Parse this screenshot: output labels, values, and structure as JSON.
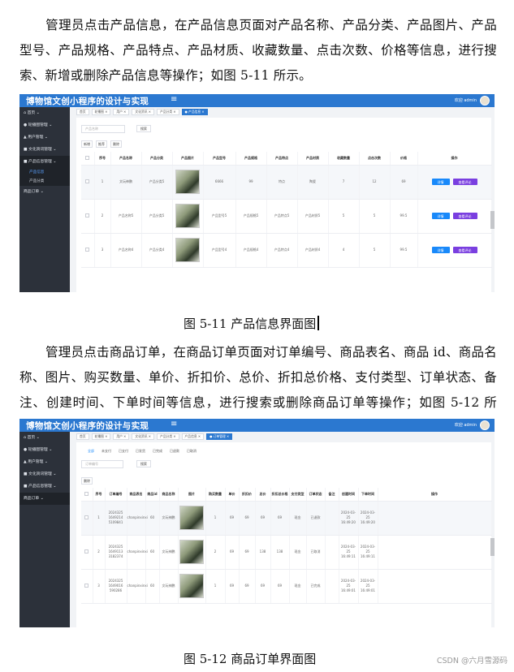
{
  "para1": "管理员点击产品信息，在产品信息页面对产品名称、产品分类、产品图片、产品型号、产品规格、产品特点、产品材质、收藏数量、点击次数、价格等信息，进行搜索、新增或删除产品信息等操作；如图 5-11 所示。",
  "caption1": "图 5-11 产品信息界面图",
  "para2": "管理员点击商品订单，在商品订单页面对订单编号、商品表名、商品 id、商品名称、图片、购买数量、单价、折扣价、总价、折扣总价格、支付类型、订单状态、备注、创建时间、下单时间等信息，进行搜索或删除商品订单等操作；如图 5-12 所示。",
  "caption2": "图 5-12 商品订单界面图",
  "watermark": "CSDN @六月雪源码",
  "app": {
    "title": "博物馆文创小程序的设计与实现",
    "menu_icon": "≡",
    "welcome": "欢迎 admin",
    "avatar_icon": "user-avatar"
  },
  "shot1": {
    "sidebar": [
      {
        "label": "⌂ 首页 ⌄",
        "active": false
      },
      {
        "label": "● 轮播图管理 ⌄",
        "active": false
      },
      {
        "label": "▲ 用户管理 ⌄",
        "active": false
      },
      {
        "label": "■ 文化资讯管理 ⌄",
        "active": false
      },
      {
        "label": "■ 产品信息管理 ⌄",
        "active": true
      }
    ],
    "sidebar_sub": [
      {
        "label": "产品信息",
        "sel": true
      },
      {
        "label": "产品分类",
        "sel": false
      }
    ],
    "sidebar_after": "商品订单 ⌄",
    "tabs": [
      {
        "label": "首页",
        "on": false
      },
      {
        "label": "轮播图 ✕",
        "on": false
      },
      {
        "label": "用户 ✕",
        "on": false
      },
      {
        "label": "文化资讯 ✕",
        "on": false
      },
      {
        "label": "产品分类 ✕",
        "on": false
      },
      {
        "label": "● 产品信息 ✕",
        "on": true
      }
    ],
    "search_placeholder": "产品名称",
    "search_btn": "搜索",
    "actions": [
      "新增",
      "推荐",
      "删除"
    ],
    "headers": [
      "",
      "序号",
      "产品名称",
      "产品分类",
      "产品图片",
      "产品型号",
      "产品规格",
      "产品特点",
      "产品材质",
      "收藏数量",
      "点击次数",
      "价格",
      "操作"
    ],
    "rows": [
      {
        "no": "1",
        "name": "文玩神鹏",
        "cat": "产品分类5",
        "model": "6666",
        "spec": "99",
        "feature": "特点",
        "material": "陶瓷",
        "fav": "7",
        "clicks": "12",
        "price": "69"
      },
      {
        "no": "2",
        "name": "产品名称5",
        "cat": "产品分类5",
        "model": "产品型号5",
        "spec": "产品规格5",
        "feature": "产品特点5",
        "material": "产品材质5",
        "fav": "5",
        "clicks": "5",
        "price": "99.5"
      },
      {
        "no": "3",
        "name": "产品名称4",
        "cat": "产品分类4",
        "model": "产品型号4",
        "spec": "产品规格4",
        "feature": "产品特点4",
        "material": "产品材质4",
        "fav": "4",
        "clicks": "5",
        "price": "99.5"
      }
    ],
    "row_btn1": "详情",
    "row_btn2": "查看评论"
  },
  "shot2": {
    "sidebar": [
      {
        "label": "⌂ 首页 ⌄",
        "active": false
      },
      {
        "label": "● 轮播图管理 ⌄",
        "active": false
      },
      {
        "label": "▲ 用户管理 ⌄",
        "active": false
      },
      {
        "label": "■ 文化资讯管理 ⌄",
        "active": false
      },
      {
        "label": "■ 产品信息管理 ⌄",
        "active": false
      },
      {
        "label": "商品订单 ⌄",
        "active": true
      }
    ],
    "tabs": [
      {
        "label": "首页",
        "on": false
      },
      {
        "label": "轮播图 ✕",
        "on": false
      },
      {
        "label": "用户 ✕",
        "on": false
      },
      {
        "label": "文化资讯 ✕",
        "on": false
      },
      {
        "label": "产品分类 ✕",
        "on": false
      },
      {
        "label": "产品信息 ✕",
        "on": false
      },
      {
        "label": "● 订单管理 ✕",
        "on": true
      }
    ],
    "status_tabs": [
      {
        "label": "全部",
        "on": true
      },
      {
        "label": "未支付",
        "on": false
      },
      {
        "label": "已支付",
        "on": false
      },
      {
        "label": "已发货",
        "on": false
      },
      {
        "label": "已完成",
        "on": false
      },
      {
        "label": "已退款",
        "on": false
      },
      {
        "label": "已取消",
        "on": false
      }
    ],
    "search_placeholder": "订单编号",
    "search_btn": "搜索",
    "delete_btn": "删除",
    "headers": [
      "",
      "序号",
      "订单编号",
      "商品表名",
      "商品id",
      "商品名称",
      "图片",
      "购买数量",
      "单价",
      "折扣价",
      "总价",
      "折扣总价格",
      "支付类型",
      "订单状态",
      "备注",
      "创建时间",
      "下单时间",
      "操作"
    ],
    "rows": [
      {
        "no": "1",
        "order": "2024325 1649214 5109841",
        "table": "chanpinxinxi",
        "gid": "60",
        "gname": "文玩神鹏",
        "qty": "1",
        "price": "69",
        "disc": "69",
        "total": "69",
        "dtotal": "69",
        "pay": "现金",
        "status": "已退款",
        "remark": "",
        "created": "2024-03-25 16:49:20",
        "ordered": "2024-03-25 16:49:20"
      },
      {
        "no": "2",
        "order": "2024325 1649113 3182374",
        "table": "chanpinxinxi",
        "gid": "60",
        "gname": "文玩神鹏",
        "qty": "2",
        "price": "69",
        "disc": "69",
        "total": "138",
        "dtotal": "138",
        "pay": "现金",
        "status": "已取消",
        "remark": "",
        "created": "2024-03-25 16:49:11",
        "ordered": "2024-03-25 16:49:11"
      },
      {
        "no": "3",
        "order": "2024325 1649016 590286",
        "table": "chanpinxinxi",
        "gid": "60",
        "gname": "文玩神鹏",
        "qty": "1",
        "price": "69",
        "disc": "69",
        "total": "69",
        "dtotal": "69",
        "pay": "现金",
        "status": "已完成",
        "remark": "",
        "created": "2024-03-25 16:49:01",
        "ordered": "2024-03-25 16:49:01"
      }
    ]
  }
}
